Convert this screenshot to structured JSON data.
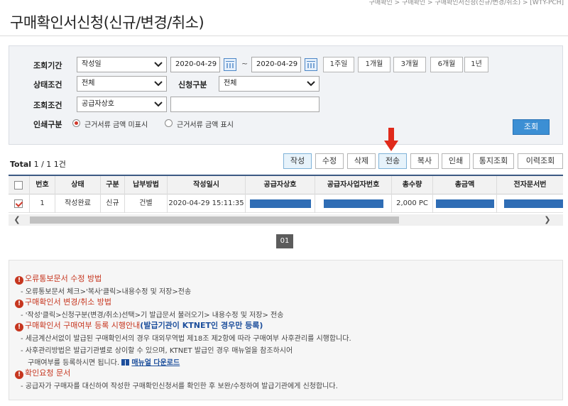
{
  "breadcrumb": "구매확인 > 구매확인 > 구매확인서신청(신규/변경/취소) > [WTY-PCH]",
  "page_title": "구매확인서신청(신규/변경/취소)",
  "search": {
    "period_label": "조회기간",
    "period_type": "작성일",
    "date_from": "2020-04-29",
    "tilde": "~",
    "date_to": "2020-04-29",
    "period_buttons": [
      "1주일",
      "1개월",
      "3개월",
      "6개월",
      "1년"
    ],
    "status_label": "상태조건",
    "status_value": "전체",
    "apply_label": "신청구분",
    "apply_value": "전체",
    "query_label": "조회조건",
    "query_field": "공급자상호",
    "query_value": "",
    "print_label": "인쇄구분",
    "print_option_1": "근거서류 금액 미표시",
    "print_option_2": "근거서류 금액 표시",
    "search_button": "조회"
  },
  "total": {
    "label": "Total",
    "current": "1",
    "sep": "/",
    "pages": "1",
    "count": "1건"
  },
  "actions": [
    "작성",
    "수정",
    "삭제",
    "전송",
    "복사",
    "인쇄",
    "통지조회",
    "이력조회"
  ],
  "grid": {
    "headers": [
      "번호",
      "상태",
      "구분",
      "납부방법",
      "작성일시",
      "공급자상호",
      "공급자사업자번호",
      "총수량",
      "총금액",
      "전자문서번"
    ],
    "row": {
      "no": "1",
      "status": "작성완료",
      "type": "신규",
      "payment": "건별",
      "created": "2020-04-29 15:11:35",
      "qty": "2,000 PC"
    }
  },
  "pager": {
    "current": "01"
  },
  "notices": {
    "h1": "오류통보문서 수정 방법",
    "l1": "- 오류통보문서 체크>'복사'클릭>내용수정 및 저장>전송",
    "h2": "구매확인서 변경/취소 방법",
    "l2": "- '작성'클릭>신청구분(변경/취소)선택>기 발급문서 불러오기> 내용수정 및 저장> 전송",
    "h3_a": "구매확인서 구매여부 등록 시행안내",
    "h3_b": "(발급기관이 KTNET인 경우만 등록)",
    "l3a": "- 세금계산서없이 발급된 구매확인서의 경우 대외무역법 제18조 제2항에 따라 구매여부 사후관리를 시행합니다.",
    "l3b": "- 사후관리방법은 발급기관별로 상이할 수 있으며, KTNET 발급인 경우 매뉴얼을 참조하시어",
    "l3c": "구매여부를 등록하시면 됩니다.",
    "manual_link": "매뉴얼 다운로드",
    "h4": "확인요청 문서",
    "l4": "- 공급자가 구매자를 대신하여 작성한 구매확인신청서를 확인한 후 보완/수정하여 발급기관에게 신청합니다."
  },
  "colors": {
    "accent": "#3c8fd4",
    "alert": "#c6361f",
    "arrow": "#e02a1b",
    "mask": "#2f6db5"
  }
}
